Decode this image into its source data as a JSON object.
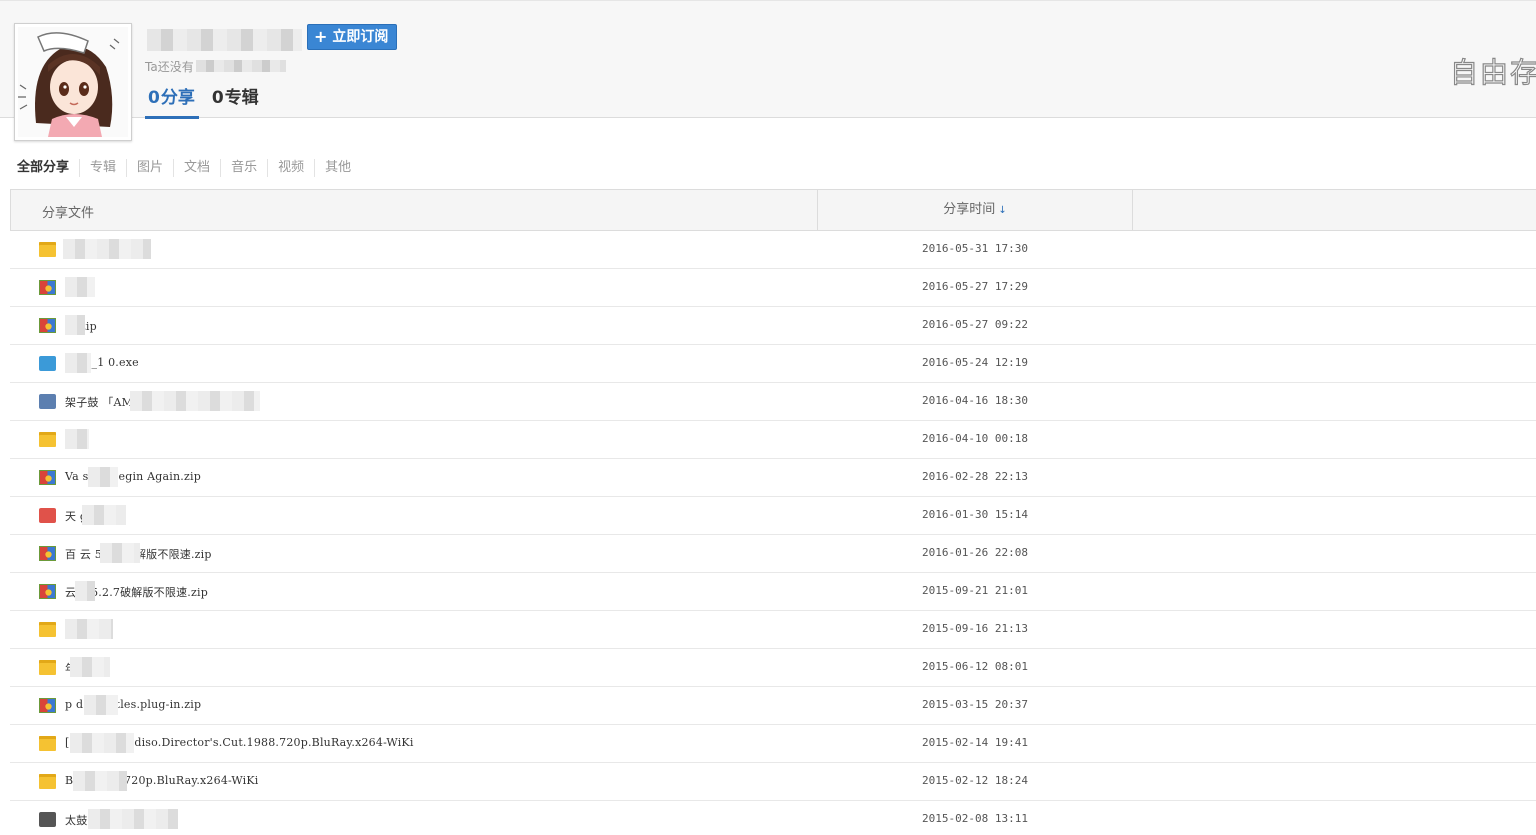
{
  "header": {
    "subscribe_label": "立即订阅",
    "subscribe_plus": "+",
    "signature_prefix": "Ta还没有",
    "stats": {
      "shares_count": "0",
      "shares_label": "分享",
      "albums_count": "0",
      "albums_label": "专辑"
    },
    "watermark_text": "自由存"
  },
  "tabs": [
    "全部分享",
    "专辑",
    "图片",
    "文档",
    "音乐",
    "视频",
    "其他"
  ],
  "table": {
    "col_name": "分享文件",
    "col_time": "分享时间",
    "sort_arrow": "↓",
    "rows": [
      {
        "icon": "folder-icon",
        "name": "",
        "time": "2016-05-31 17:30"
      },
      {
        "icon": "zip-icon",
        "name": "",
        "time": "2016-05-27 17:29"
      },
      {
        "icon": "zip-icon",
        "name": "章.zip",
        "time": "2016-05-27 09:22"
      },
      {
        "icon": "exe-icon",
        "name": "_x64_1 0.exe",
        "time": "2016-05-24 12:19"
      },
      {
        "icon": "video-icon",
        "name": "架子鼓 「AMI」 Butt 田光司.flv",
        "time": "2016-04-16 18:30"
      },
      {
        "icon": "folder-icon",
        "name": "模板",
        "time": "2016-04-10 00:18"
      },
      {
        "icon": "zip-icon",
        "name": "Va sts - Begin Again.zip",
        "time": "2016-02-28 22:13"
      },
      {
        "icon": "image-icon",
        "name": "天 g",
        "time": "2016-01-30 15:14"
      },
      {
        "icon": "zip-icon",
        "name": "百 云 5.2.7破解版不限速.zip",
        "time": "2016-01-26 22:08"
      },
      {
        "icon": "zip-icon",
        "name": "云 云5.2.7破解版不限速.zip",
        "time": "2015-09-21 21:01"
      },
      {
        "icon": "folder-icon",
        "name": "",
        "time": "2015-09-16 21:13"
      },
      {
        "icon": "folder-icon",
        "name": "年",
        "time": "2015-06-12 08:01"
      },
      {
        "icon": "zip-icon",
        "name": "p d.subtitles.plug-in.zip",
        "time": "2015-03-15 20:37"
      },
      {
        "icon": "folder-icon",
        "name": "[ nema.Paradiso.Director's.Cut.1988.720p.BluRay.x264-WiKi",
        "time": "2015-02-14 19:41"
      },
      {
        "icon": "folder-icon",
        "name": "B .6.2014.720p.BluRay.x264-WiKi",
        "time": "2015-02-12 18:24"
      },
      {
        "icon": "ipa-icon",
        "name": "太鼓 ipa",
        "time": "2015-02-08 13:11"
      }
    ]
  },
  "colors": {
    "accent": "#2d6fb8",
    "button_bg": "#3a86d4",
    "folder": "#f5c232"
  }
}
